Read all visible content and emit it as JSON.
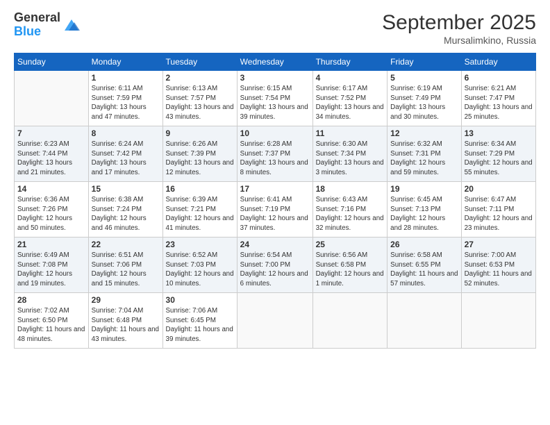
{
  "logo": {
    "general": "General",
    "blue": "Blue"
  },
  "title": "September 2025",
  "location": "Mursalimkino, Russia",
  "days_of_week": [
    "Sunday",
    "Monday",
    "Tuesday",
    "Wednesday",
    "Thursday",
    "Friday",
    "Saturday"
  ],
  "weeks": [
    [
      {
        "day": null,
        "sunrise": null,
        "sunset": null,
        "daylight": null
      },
      {
        "day": "1",
        "sunrise": "Sunrise: 6:11 AM",
        "sunset": "Sunset: 7:59 PM",
        "daylight": "Daylight: 13 hours and 47 minutes."
      },
      {
        "day": "2",
        "sunrise": "Sunrise: 6:13 AM",
        "sunset": "Sunset: 7:57 PM",
        "daylight": "Daylight: 13 hours and 43 minutes."
      },
      {
        "day": "3",
        "sunrise": "Sunrise: 6:15 AM",
        "sunset": "Sunset: 7:54 PM",
        "daylight": "Daylight: 13 hours and 39 minutes."
      },
      {
        "day": "4",
        "sunrise": "Sunrise: 6:17 AM",
        "sunset": "Sunset: 7:52 PM",
        "daylight": "Daylight: 13 hours and 34 minutes."
      },
      {
        "day": "5",
        "sunrise": "Sunrise: 6:19 AM",
        "sunset": "Sunset: 7:49 PM",
        "daylight": "Daylight: 13 hours and 30 minutes."
      },
      {
        "day": "6",
        "sunrise": "Sunrise: 6:21 AM",
        "sunset": "Sunset: 7:47 PM",
        "daylight": "Daylight: 13 hours and 25 minutes."
      }
    ],
    [
      {
        "day": "7",
        "sunrise": "Sunrise: 6:23 AM",
        "sunset": "Sunset: 7:44 PM",
        "daylight": "Daylight: 13 hours and 21 minutes."
      },
      {
        "day": "8",
        "sunrise": "Sunrise: 6:24 AM",
        "sunset": "Sunset: 7:42 PM",
        "daylight": "Daylight: 13 hours and 17 minutes."
      },
      {
        "day": "9",
        "sunrise": "Sunrise: 6:26 AM",
        "sunset": "Sunset: 7:39 PM",
        "daylight": "Daylight: 13 hours and 12 minutes."
      },
      {
        "day": "10",
        "sunrise": "Sunrise: 6:28 AM",
        "sunset": "Sunset: 7:37 PM",
        "daylight": "Daylight: 13 hours and 8 minutes."
      },
      {
        "day": "11",
        "sunrise": "Sunrise: 6:30 AM",
        "sunset": "Sunset: 7:34 PM",
        "daylight": "Daylight: 13 hours and 3 minutes."
      },
      {
        "day": "12",
        "sunrise": "Sunrise: 6:32 AM",
        "sunset": "Sunset: 7:31 PM",
        "daylight": "Daylight: 12 hours and 59 minutes."
      },
      {
        "day": "13",
        "sunrise": "Sunrise: 6:34 AM",
        "sunset": "Sunset: 7:29 PM",
        "daylight": "Daylight: 12 hours and 55 minutes."
      }
    ],
    [
      {
        "day": "14",
        "sunrise": "Sunrise: 6:36 AM",
        "sunset": "Sunset: 7:26 PM",
        "daylight": "Daylight: 12 hours and 50 minutes."
      },
      {
        "day": "15",
        "sunrise": "Sunrise: 6:38 AM",
        "sunset": "Sunset: 7:24 PM",
        "daylight": "Daylight: 12 hours and 46 minutes."
      },
      {
        "day": "16",
        "sunrise": "Sunrise: 6:39 AM",
        "sunset": "Sunset: 7:21 PM",
        "daylight": "Daylight: 12 hours and 41 minutes."
      },
      {
        "day": "17",
        "sunrise": "Sunrise: 6:41 AM",
        "sunset": "Sunset: 7:19 PM",
        "daylight": "Daylight: 12 hours and 37 minutes."
      },
      {
        "day": "18",
        "sunrise": "Sunrise: 6:43 AM",
        "sunset": "Sunset: 7:16 PM",
        "daylight": "Daylight: 12 hours and 32 minutes."
      },
      {
        "day": "19",
        "sunrise": "Sunrise: 6:45 AM",
        "sunset": "Sunset: 7:13 PM",
        "daylight": "Daylight: 12 hours and 28 minutes."
      },
      {
        "day": "20",
        "sunrise": "Sunrise: 6:47 AM",
        "sunset": "Sunset: 7:11 PM",
        "daylight": "Daylight: 12 hours and 23 minutes."
      }
    ],
    [
      {
        "day": "21",
        "sunrise": "Sunrise: 6:49 AM",
        "sunset": "Sunset: 7:08 PM",
        "daylight": "Daylight: 12 hours and 19 minutes."
      },
      {
        "day": "22",
        "sunrise": "Sunrise: 6:51 AM",
        "sunset": "Sunset: 7:06 PM",
        "daylight": "Daylight: 12 hours and 15 minutes."
      },
      {
        "day": "23",
        "sunrise": "Sunrise: 6:52 AM",
        "sunset": "Sunset: 7:03 PM",
        "daylight": "Daylight: 12 hours and 10 minutes."
      },
      {
        "day": "24",
        "sunrise": "Sunrise: 6:54 AM",
        "sunset": "Sunset: 7:00 PM",
        "daylight": "Daylight: 12 hours and 6 minutes."
      },
      {
        "day": "25",
        "sunrise": "Sunrise: 6:56 AM",
        "sunset": "Sunset: 6:58 PM",
        "daylight": "Daylight: 12 hours and 1 minute."
      },
      {
        "day": "26",
        "sunrise": "Sunrise: 6:58 AM",
        "sunset": "Sunset: 6:55 PM",
        "daylight": "Daylight: 11 hours and 57 minutes."
      },
      {
        "day": "27",
        "sunrise": "Sunrise: 7:00 AM",
        "sunset": "Sunset: 6:53 PM",
        "daylight": "Daylight: 11 hours and 52 minutes."
      }
    ],
    [
      {
        "day": "28",
        "sunrise": "Sunrise: 7:02 AM",
        "sunset": "Sunset: 6:50 PM",
        "daylight": "Daylight: 11 hours and 48 minutes."
      },
      {
        "day": "29",
        "sunrise": "Sunrise: 7:04 AM",
        "sunset": "Sunset: 6:48 PM",
        "daylight": "Daylight: 11 hours and 43 minutes."
      },
      {
        "day": "30",
        "sunrise": "Sunrise: 7:06 AM",
        "sunset": "Sunset: 6:45 PM",
        "daylight": "Daylight: 11 hours and 39 minutes."
      },
      {
        "day": null,
        "sunrise": null,
        "sunset": null,
        "daylight": null
      },
      {
        "day": null,
        "sunrise": null,
        "sunset": null,
        "daylight": null
      },
      {
        "day": null,
        "sunrise": null,
        "sunset": null,
        "daylight": null
      },
      {
        "day": null,
        "sunrise": null,
        "sunset": null,
        "daylight": null
      }
    ]
  ]
}
